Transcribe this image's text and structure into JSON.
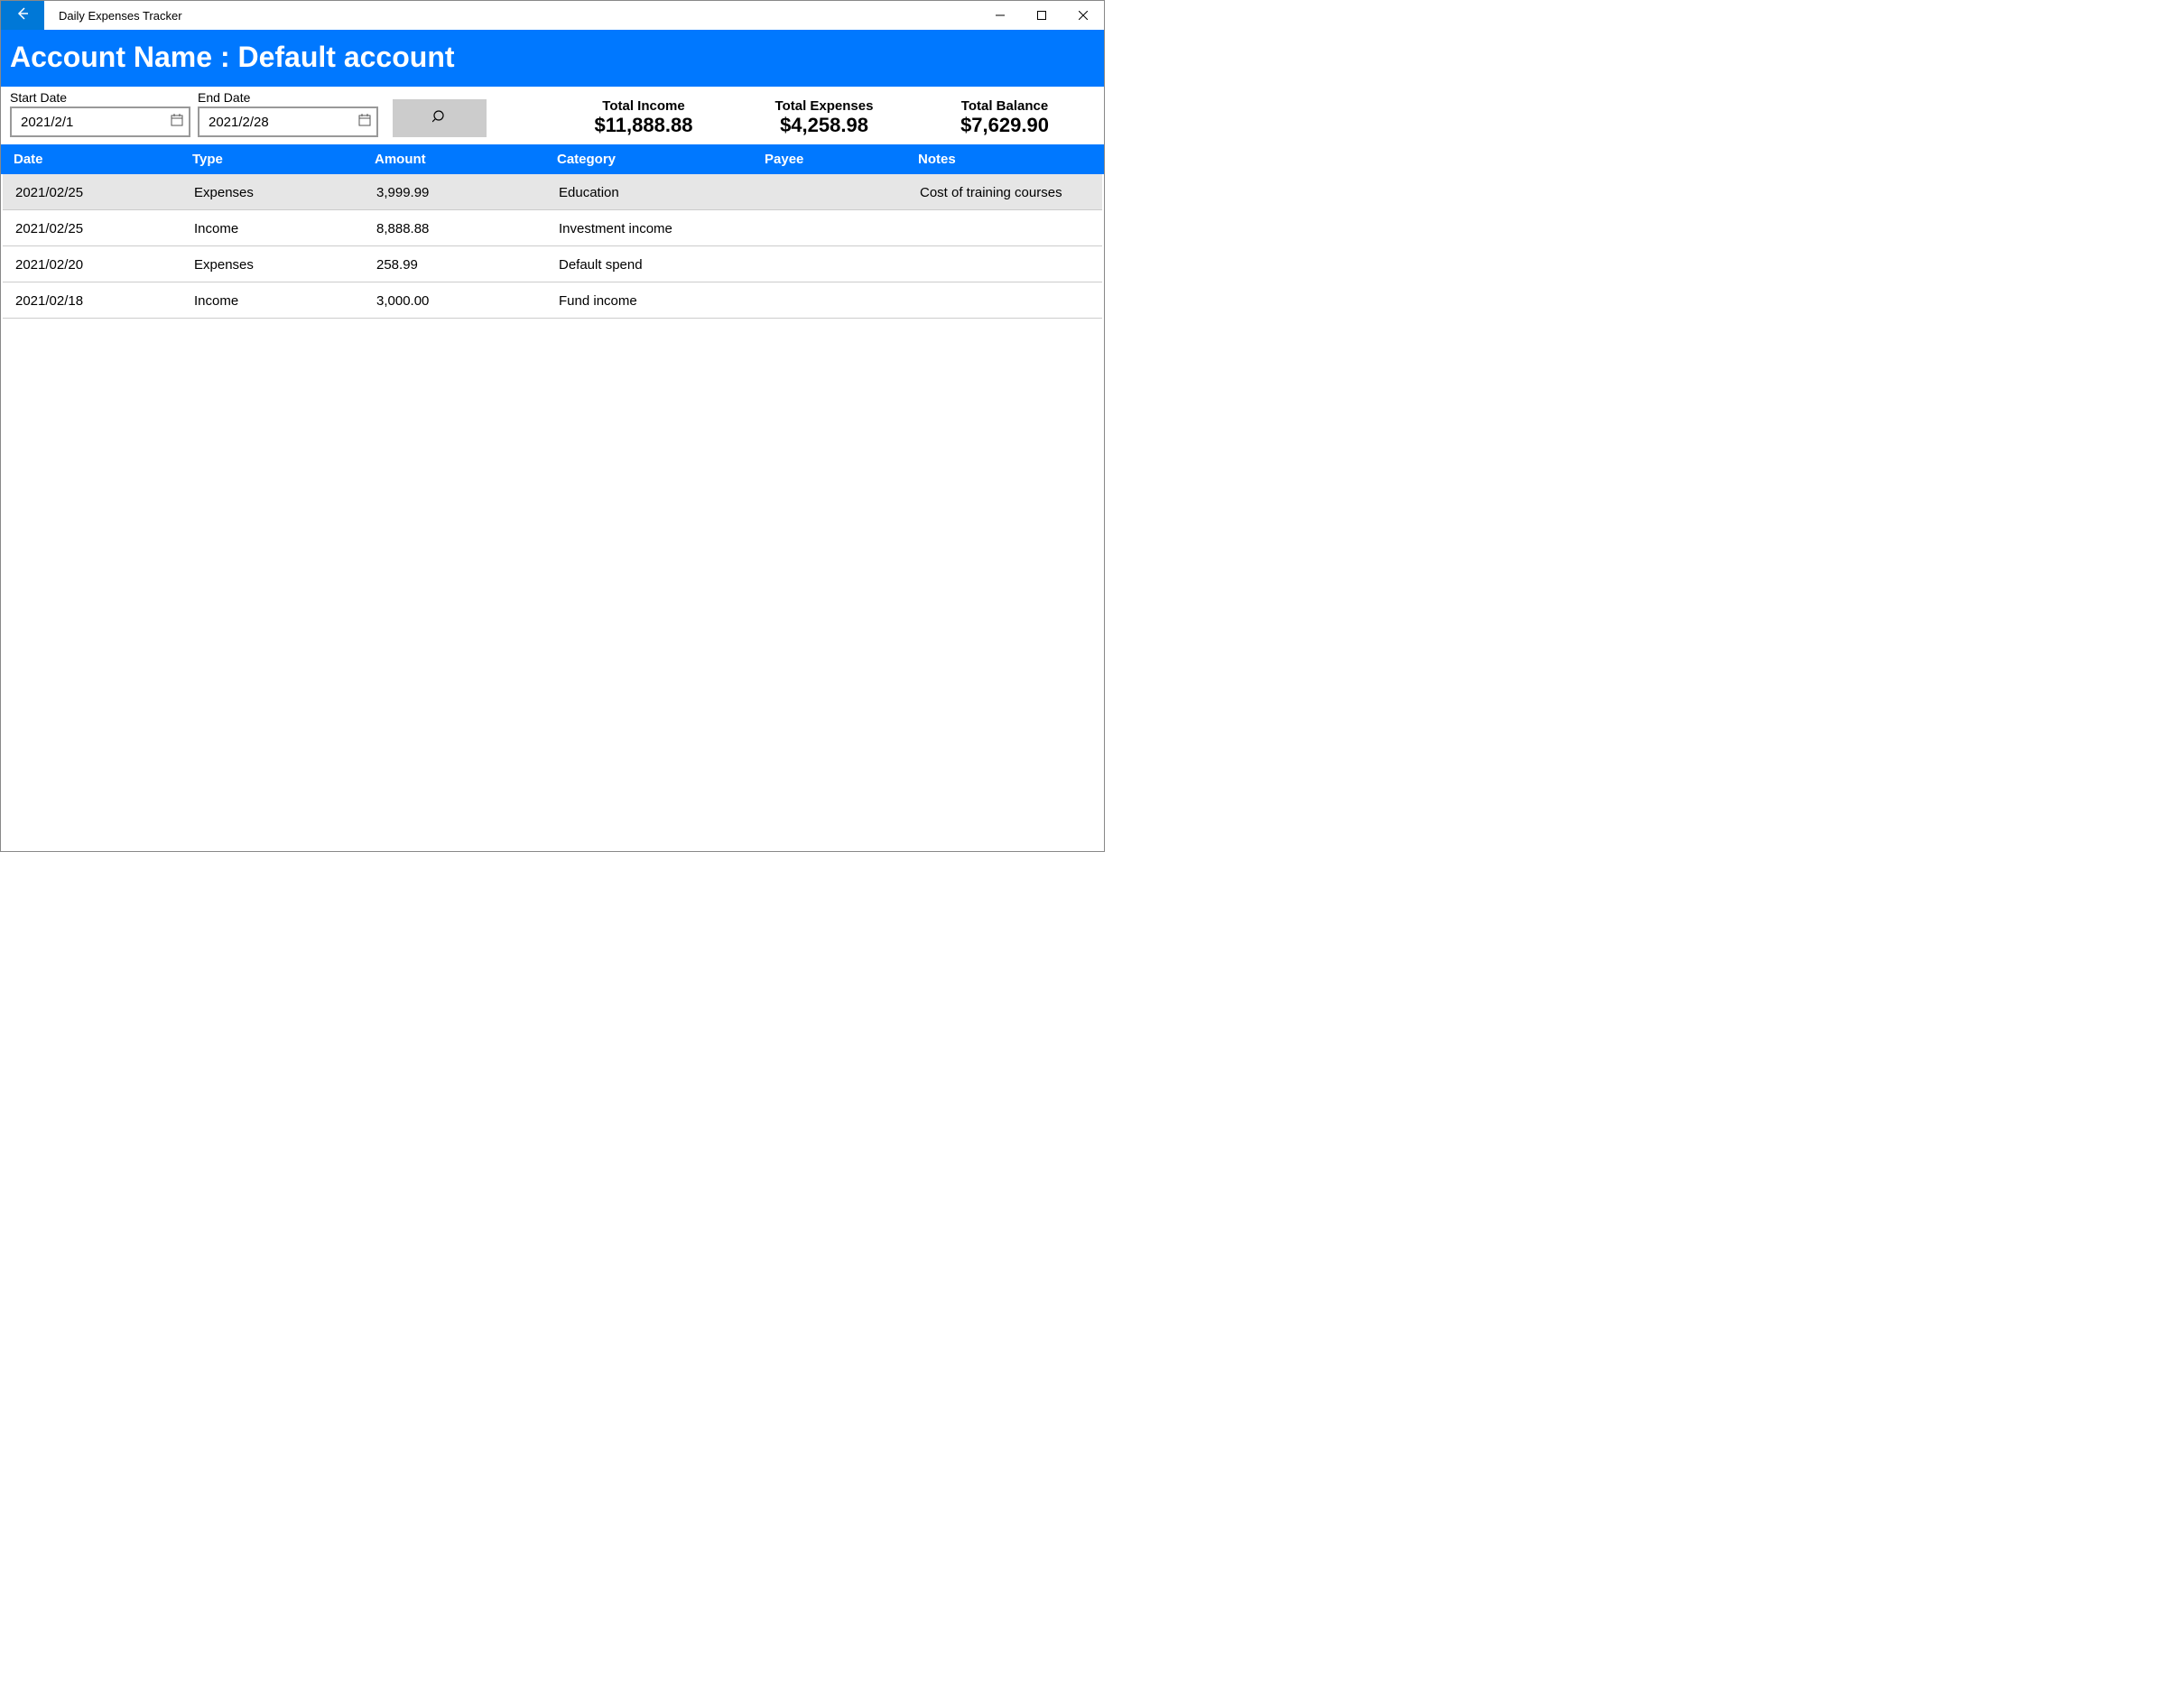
{
  "window": {
    "title": "Daily Expenses Tracker"
  },
  "header": {
    "account_line": "Account Name : Default account"
  },
  "filters": {
    "start_label": "Start Date",
    "start_value": "2021/2/1",
    "end_label": "End Date",
    "end_value": "2021/2/28"
  },
  "summary": {
    "income_label": "Total Income",
    "income_value": "$11,888.88",
    "expenses_label": "Total Expenses",
    "expenses_value": "$4,258.98",
    "balance_label": "Total Balance",
    "balance_value": "$7,629.90"
  },
  "columns": {
    "date": "Date",
    "type": "Type",
    "amount": "Amount",
    "category": "Category",
    "payee": "Payee",
    "notes": "Notes"
  },
  "rows": [
    {
      "date": "2021/02/25",
      "type": "Expenses",
      "amount": "3,999.99",
      "category": "Education",
      "payee": "",
      "notes": "Cost of training courses"
    },
    {
      "date": "2021/02/25",
      "type": "Income",
      "amount": "8,888.88",
      "category": "Investment income",
      "payee": "",
      "notes": ""
    },
    {
      "date": "2021/02/20",
      "type": "Expenses",
      "amount": "258.99",
      "category": "Default spend",
      "payee": "",
      "notes": ""
    },
    {
      "date": "2021/02/18",
      "type": "Income",
      "amount": "3,000.00",
      "category": "Fund income",
      "payee": "",
      "notes": ""
    }
  ]
}
